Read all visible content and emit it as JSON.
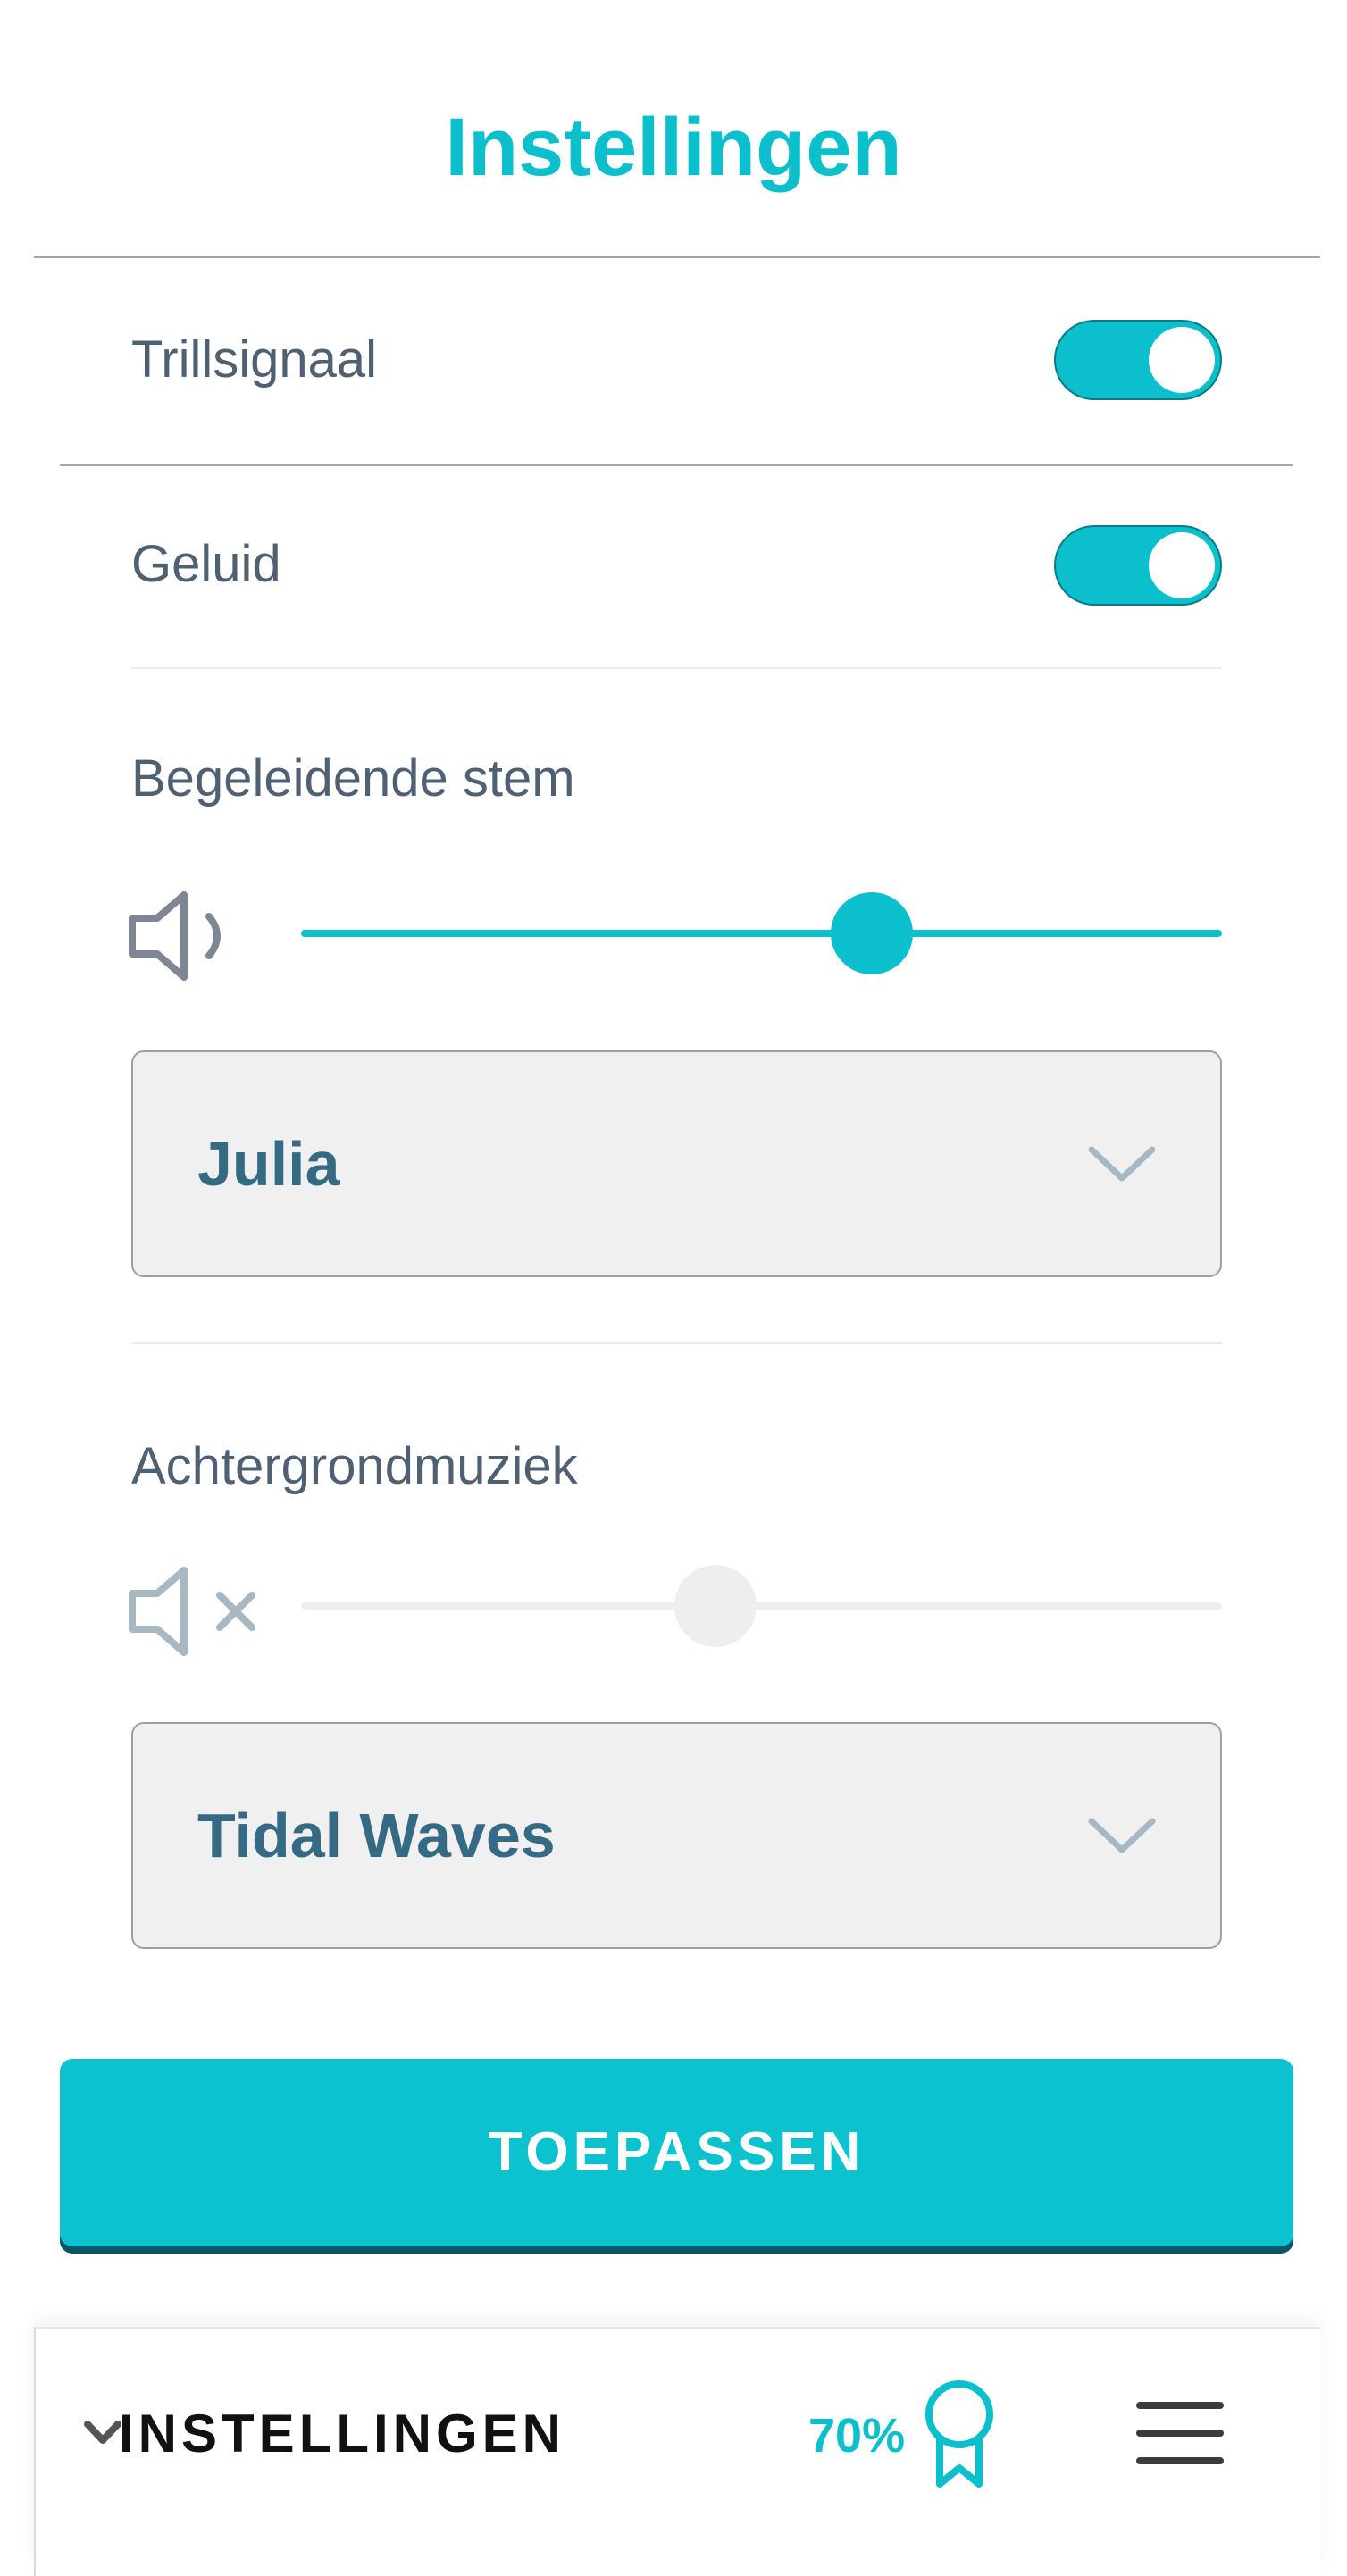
{
  "header": {
    "title": "Instellingen"
  },
  "settings": {
    "vibration": {
      "label": "Trillsignaal",
      "enabled": true
    },
    "sound": {
      "label": "Geluid",
      "enabled": true
    },
    "voice": {
      "label": "Begeleidende stem",
      "volume": 0.62,
      "selected": "Julia",
      "icon": "speaker-icon"
    },
    "music": {
      "label": "Achtergrondmuziek",
      "volume": 0.45,
      "muted": true,
      "selected": "Tidal Waves",
      "icon": "speaker-muted-icon"
    }
  },
  "actions": {
    "apply_label": "TOEPASSEN"
  },
  "bottom_bar": {
    "label": "INSTELLINGEN",
    "progress": "70%",
    "progress_icon": "award-ribbon-icon",
    "menu_icon": "hamburger-menu-icon"
  },
  "colors": {
    "accent": "#0bbfcd",
    "text": "#4f6073",
    "select_text": "#356a85",
    "disabled": "#eeeeee"
  }
}
